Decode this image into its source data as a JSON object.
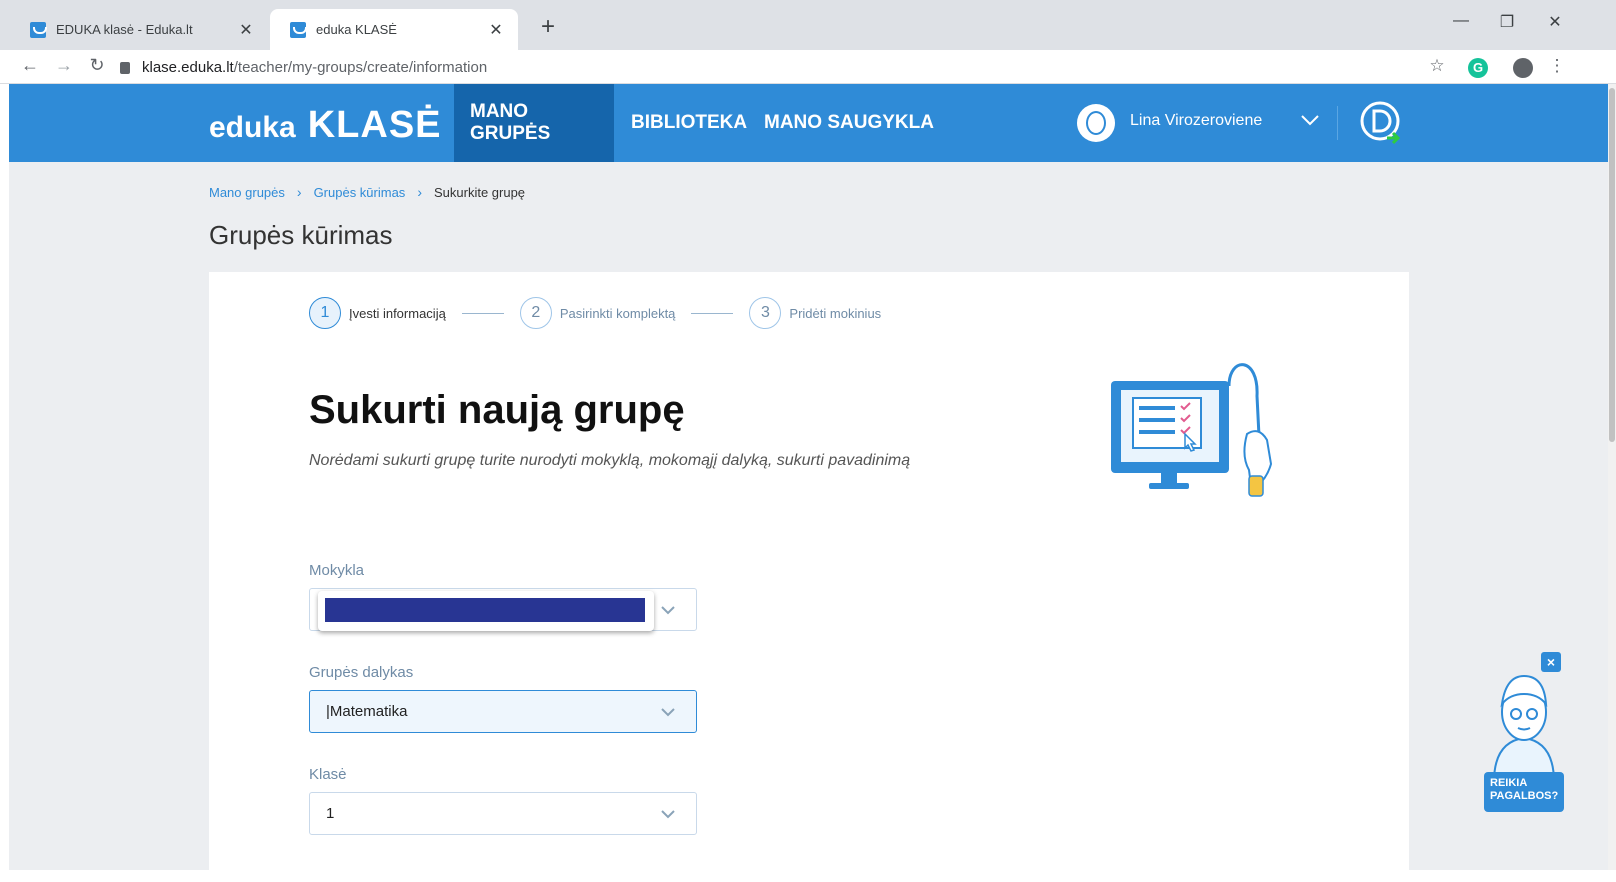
{
  "browser": {
    "tabs": [
      {
        "title": "EDUKA klasė - Eduka.lt",
        "active": false
      },
      {
        "title": "eduka KLASĖ",
        "active": true
      }
    ],
    "url_host": "klase.eduka.lt",
    "url_path": "/teacher/my-groups/create/information"
  },
  "header": {
    "logo_part1": "eduka",
    "logo_part2": "KLASĖ",
    "nav": [
      {
        "label": "MANO GRUPĖS",
        "active": true
      },
      {
        "label": "BIBLIOTEKA",
        "active": false
      },
      {
        "label": "MANO SAUGYKLA",
        "active": false
      }
    ],
    "user_name": "Lina Virozeroviene",
    "brand_color": "#2f8bd7"
  },
  "breadcrumb": [
    "Mano grupės",
    "Grupės kūrimas",
    "Sukurkite grupę"
  ],
  "page_title": "Grupės kūrimas",
  "stepper": [
    {
      "number": "1",
      "label": "Įvesti informaciją",
      "active": true
    },
    {
      "number": "2",
      "label": "Pasirinkti komplektą",
      "active": false
    },
    {
      "number": "3",
      "label": "Pridėti mokinius",
      "active": false
    }
  ],
  "form": {
    "heading": "Sukurti naują grupę",
    "subheading": "Norėdami sukurti grupę turite nurodyti mokyklą, mokomąjį dalyką, sukurti pavadinimą",
    "school_label": "Mokykla",
    "school_value": "",
    "subject_label": "Grupės dalykas",
    "subject_value": "|Matematika",
    "grade_label": "Klasė",
    "grade_value": "1"
  },
  "help": {
    "line1": "REIKIA",
    "line2": "PAGALBOS?",
    "close": "×"
  }
}
